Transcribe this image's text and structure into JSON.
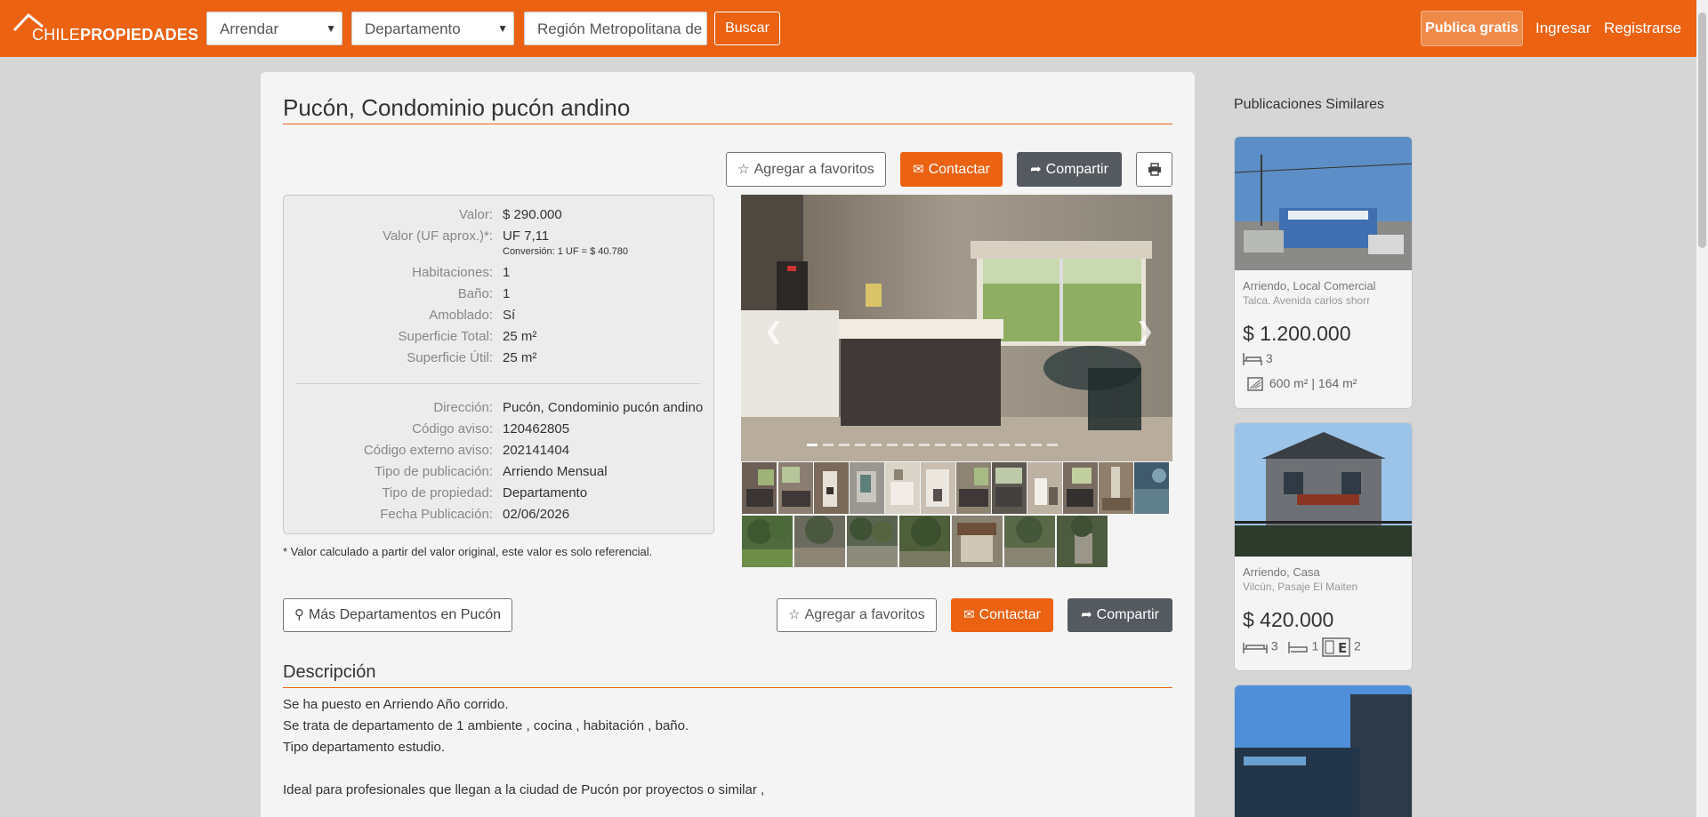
{
  "header": {
    "logo": {
      "part1": "CHILE",
      "part2": "PROPIEDADES"
    },
    "operation_select": "Arrendar",
    "type_select": "Departamento",
    "location_value": "Región Metropolitana de",
    "search_label": "Buscar",
    "publish_label": "Publica gratis",
    "login_label": "Ingresar",
    "register_label": "Registrarse"
  },
  "listing": {
    "title": "Pucón, Condominio pucón andino",
    "actions": {
      "favorite": "Agregar a favoritos",
      "contact": "Contactar",
      "share": "Compartir",
      "print_icon": "print-icon"
    },
    "details": [
      {
        "label": "Valor:",
        "value": "$ 290.000"
      },
      {
        "label": "Valor (UF aprox.)*:",
        "value": "UF 7,11"
      },
      {
        "label": "Habitaciones:",
        "value": "1"
      },
      {
        "label": "Baño:",
        "value": "1"
      },
      {
        "label": "Amoblado:",
        "value": "Sí"
      },
      {
        "label": "Superficie Total:",
        "value": "25 m²"
      },
      {
        "label": "Superficie Útil:",
        "value": "25 m²"
      }
    ],
    "conversion_note": "Conversión: 1 UF = $ 40.780",
    "details2": [
      {
        "label": "Dirección:",
        "value": "Pucón, Condominio pucón andino"
      },
      {
        "label": "Código aviso:",
        "value": "120462805"
      },
      {
        "label": "Código externo aviso:",
        "value": "202141404"
      },
      {
        "label": "Tipo de publicación:",
        "value": "Arriendo Mensual"
      },
      {
        "label": "Tipo de propiedad:",
        "value": "Departamento"
      },
      {
        "label": "Fecha Publicación:",
        "value": "02/06/2026"
      }
    ],
    "footnote": "* Valor calculado a partir del valor original, este valor es solo referencial.",
    "more_label": "Más Departamentos en Pucón",
    "description_title": "Descripción",
    "description_lines": [
      "Se ha puesto en Arriendo Año corrido.",
      "Se trata de departamento de 1 ambiente , cocina , habitación , baño.",
      "Tipo departamento estudio.",
      "",
      "Ideal para profesionales que llegan a la ciudad de Pucón por proyectos o similar ,"
    ],
    "gallery": {
      "slide_count": 16,
      "active_slide": 1,
      "thumbnail_count": 19
    }
  },
  "sidebar": {
    "title": "Publicaciones Similares",
    "cards": [
      {
        "type": "Arriendo, Local Comercial",
        "address": "Talca. Avenida carlos shorr",
        "price": "$ 1.200.000",
        "feat1": "3",
        "feat2": "600 m² | 164 m²"
      },
      {
        "type": "Arriendo, Casa",
        "address": "Vilcún, Pasaje El Maiten",
        "price": "$ 420.000",
        "feat_bed": "3",
        "feat_bath": "1",
        "feat_park": "2"
      },
      {
        "type": "",
        "address": "",
        "price": ""
      }
    ]
  },
  "colors": {
    "brand": "#ea6212",
    "dark_button": "#555a60"
  }
}
